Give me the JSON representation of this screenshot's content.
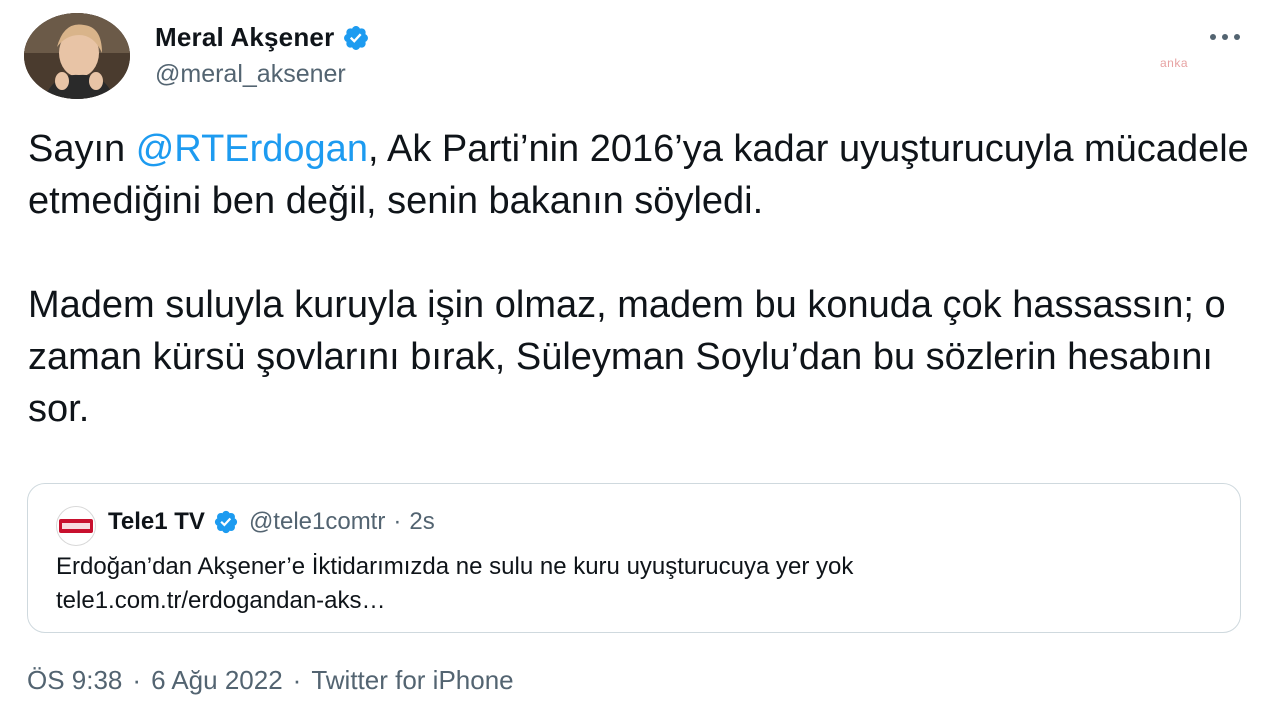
{
  "author": {
    "name": "Meral Akşener",
    "handle": "@meral_aksener"
  },
  "watermark": "anka",
  "tweet": {
    "mention": "@RTErdogan",
    "line1_before": "Sayın ",
    "line1_after": ", Ak Parti’nin 2016’ya kadar uyuşturucuyla mücadele etmediğini ben değil, senin bakanın söyledi.",
    "paragraph2": "Madem suluyla kuruyla işin olmaz, madem bu konuda çok hassassın; o zaman kürsü şovlarını bırak, Süleyman Soylu’dan bu sözlerin hesabını sor."
  },
  "quote": {
    "logo_text": "TELE1",
    "name": "Tele1 TV",
    "handle": "@tele1comtr",
    "dot": "·",
    "time": "2s",
    "text": "Erdoğan’dan Akşener’e İktidarımızda ne sulu ne kuru uyuşturucuya yer yok",
    "link": "tele1.com.tr/erdogandan-aks…"
  },
  "meta": {
    "time": "ÖS 9:38",
    "sep": "·",
    "date": "6 Ağu 2022",
    "client": "Twitter for iPhone"
  },
  "colors": {
    "accent": "#1d9bf0",
    "text": "#0f1419",
    "secondary": "#536471",
    "border": "#cfd9de"
  },
  "icons": {
    "verified": "verified-badge-icon",
    "more": "more-options-icon"
  }
}
